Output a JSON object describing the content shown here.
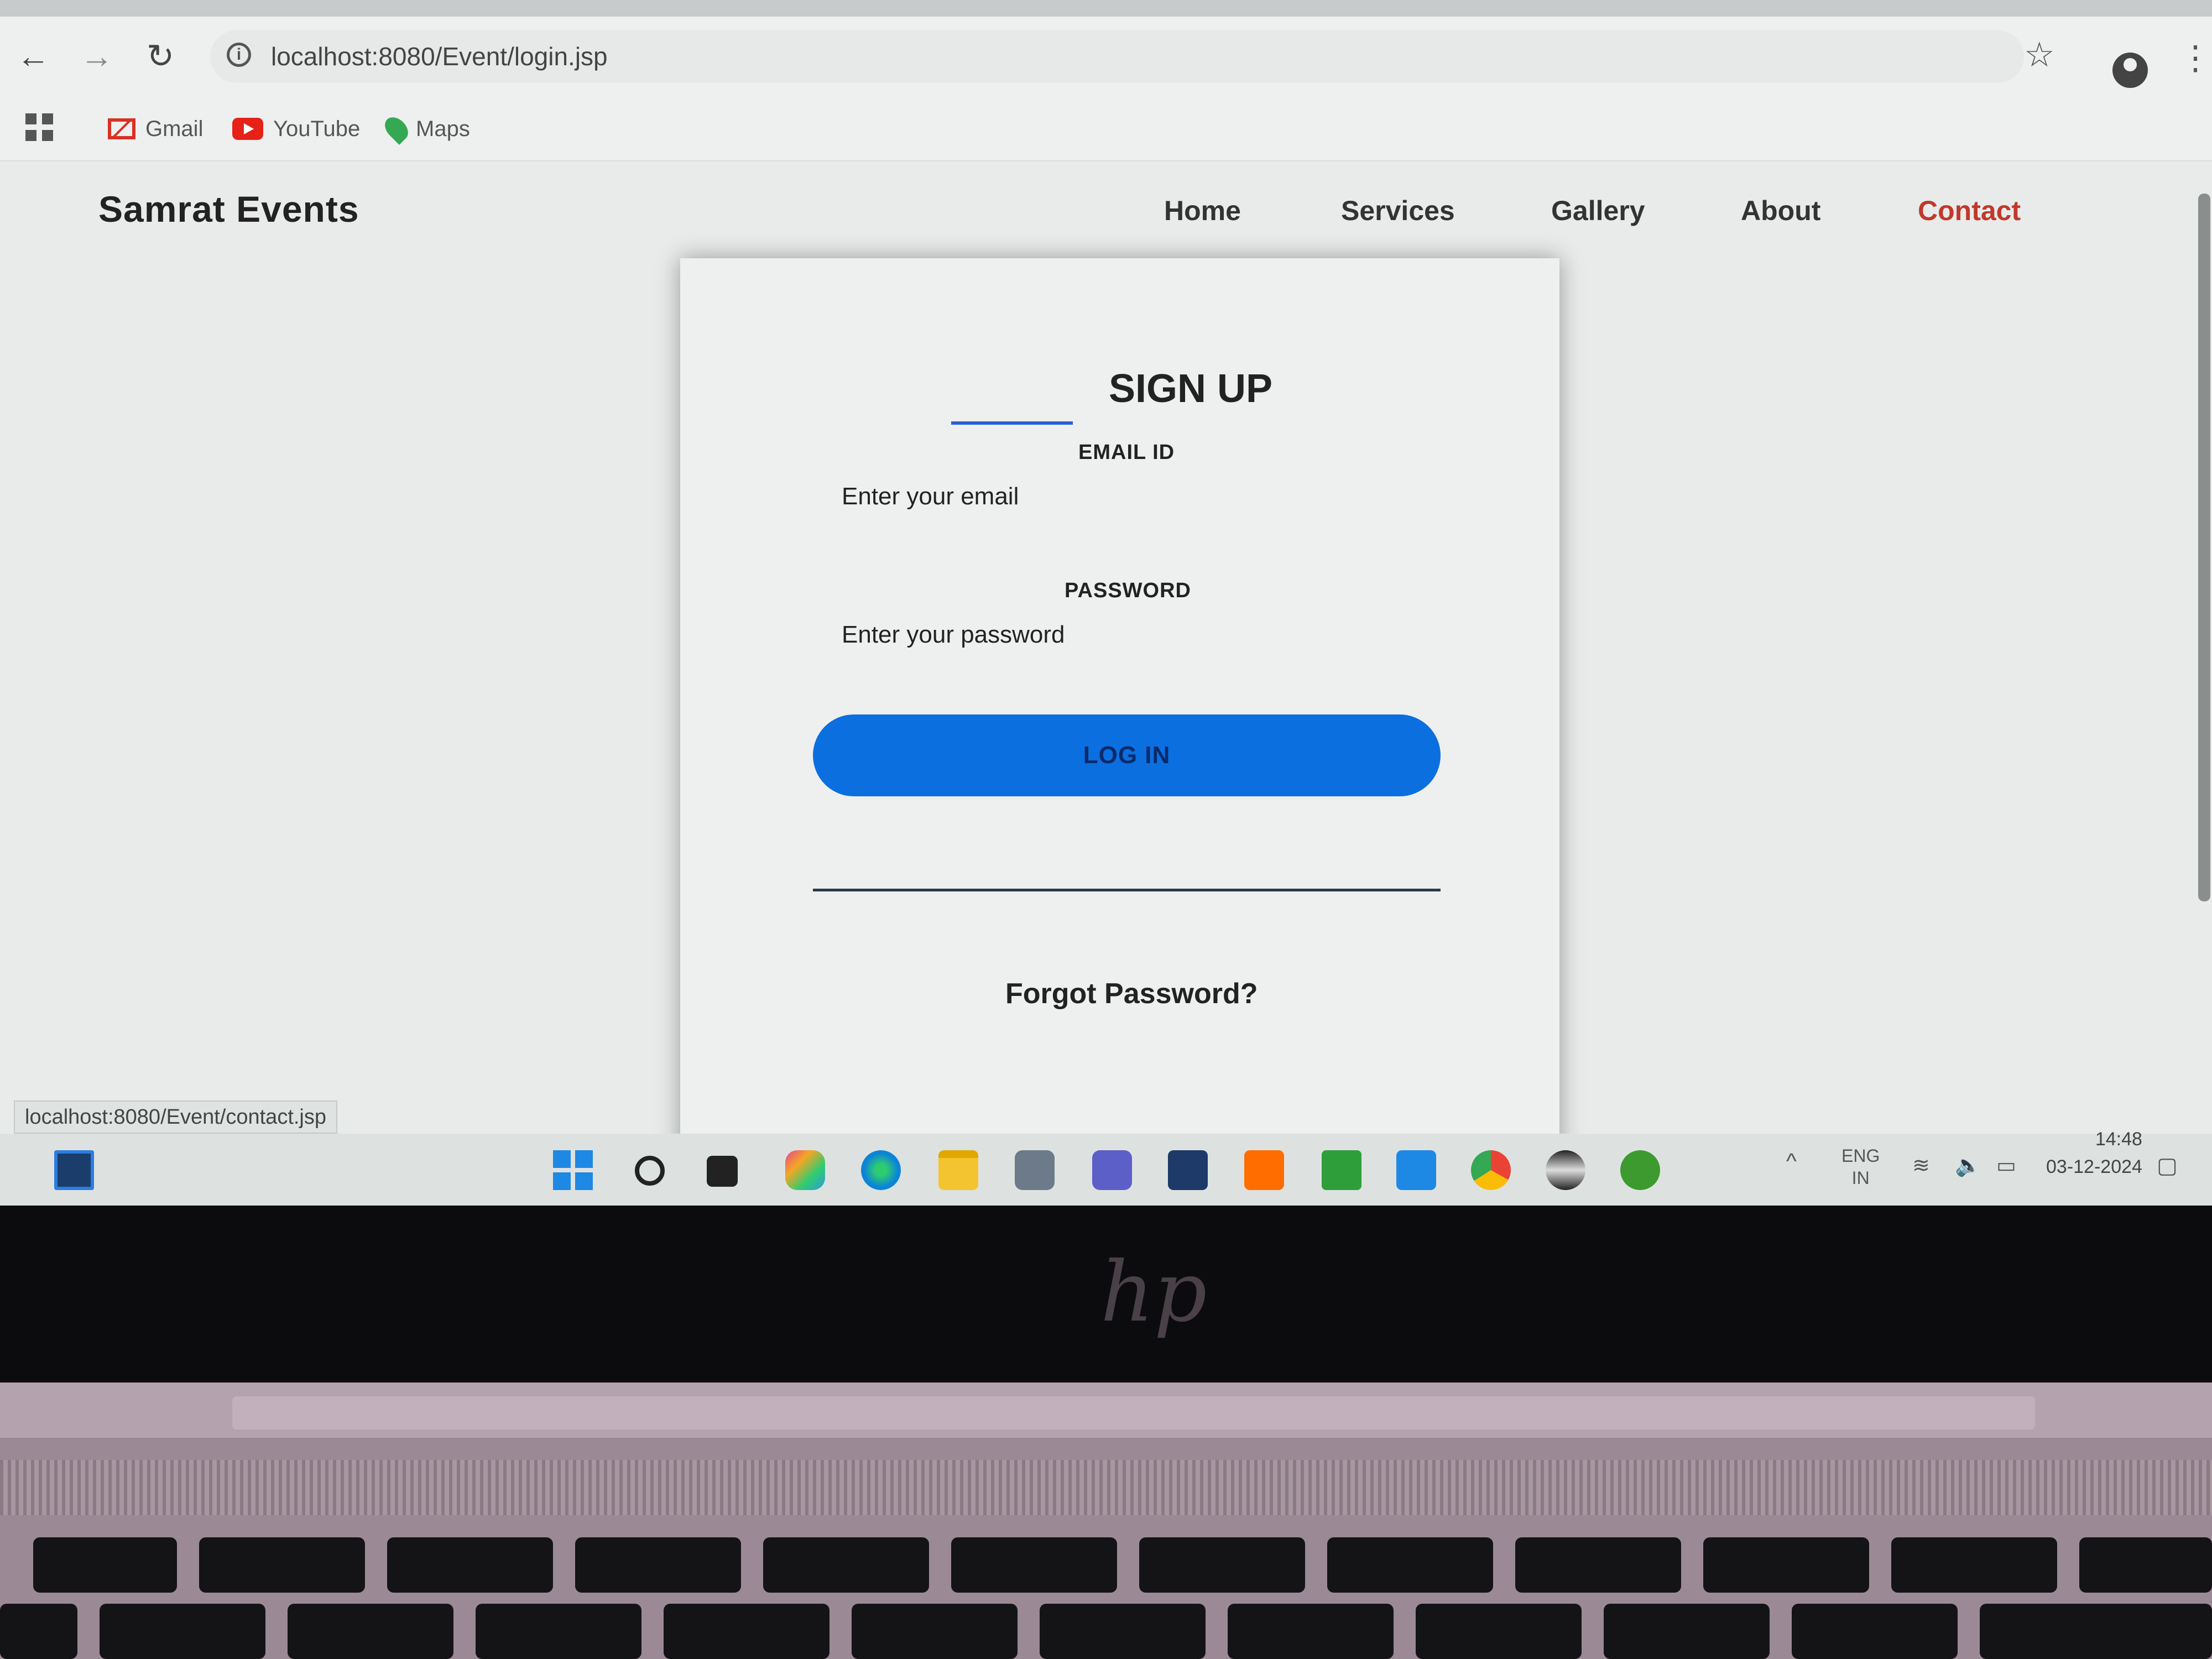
{
  "browser": {
    "url": "localhost:8080/Event/login.jsp",
    "bookmarks": [
      {
        "label": "Gmail",
        "icon": "gmail-icon"
      },
      {
        "label": "YouTube",
        "icon": "youtube-icon"
      },
      {
        "label": "Maps",
        "icon": "maps-icon"
      }
    ],
    "status_url": "localhost:8080/Event/contact.jsp"
  },
  "site": {
    "brand": "Samrat Events",
    "nav": [
      "Home",
      "Services",
      "Gallery",
      "About",
      "Contact"
    ]
  },
  "form": {
    "title": "SIGN UP",
    "email_label": "EMAIL ID",
    "email_placeholder": "Enter your email",
    "password_label": "PASSWORD",
    "password_placeholder": "Enter your password",
    "login_button": "LOG IN",
    "forgot": "Forgot Password?"
  },
  "taskbar": {
    "lang_top": "ENG",
    "lang_bottom": "IN",
    "time": "14:48",
    "date": "03-12-2024"
  },
  "colors": {
    "accent_blue": "#0b6fe0",
    "contact_red": "#c0392b"
  }
}
